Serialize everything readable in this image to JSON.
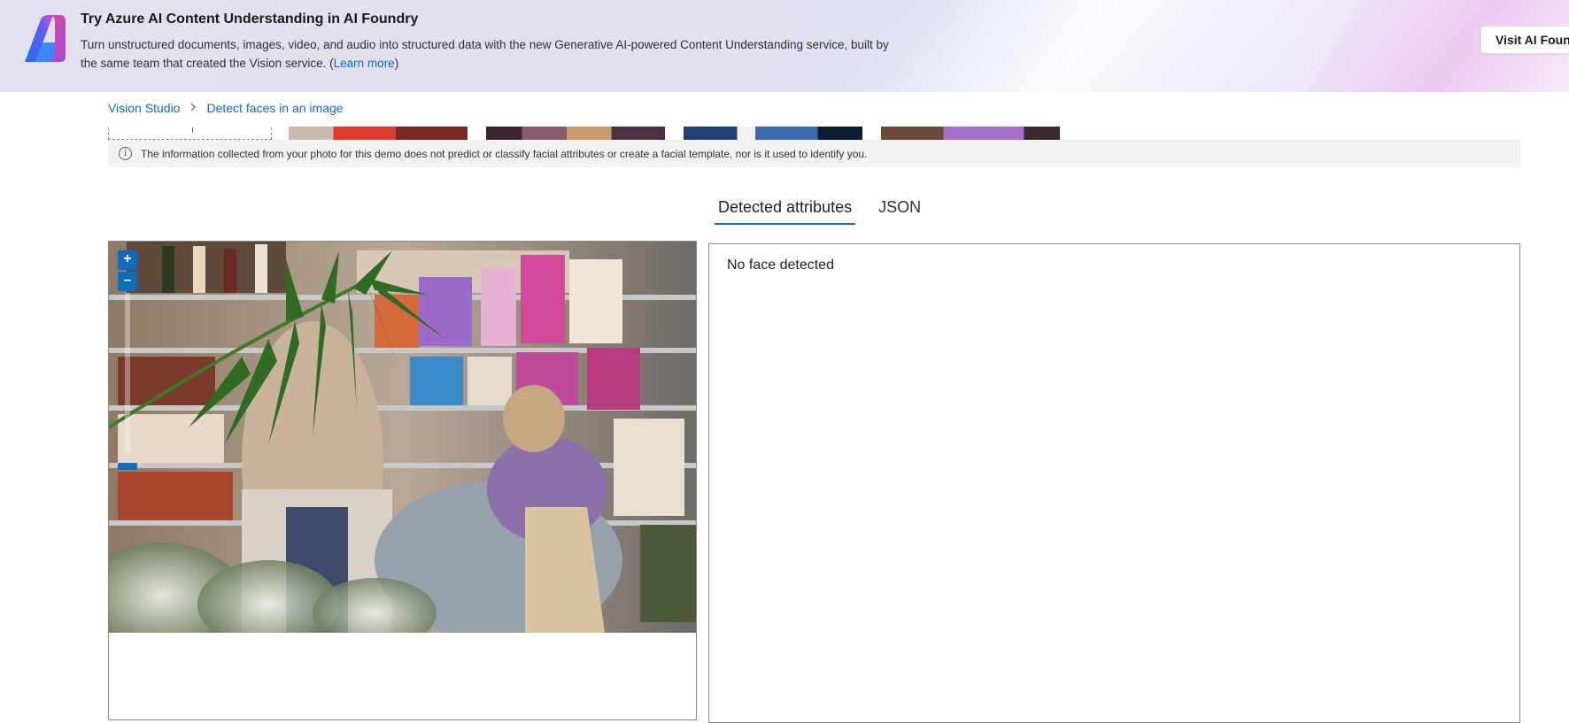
{
  "banner": {
    "title": "Try Azure AI Content Understanding in AI Foundry",
    "description": "Turn unstructured documents, images, video, and audio into structured data with the new Generative AI-powered Content Understanding service, built by the same team that created the Vision service. (",
    "learn_more": "Learn more",
    "desc_close": ")",
    "visit_button": "Visit AI Foundry",
    "logo_icon": "azure-ai-foundry-logo"
  },
  "breadcrumb": {
    "items": [
      "Vision Studio",
      "Detect faces in an image"
    ],
    "separator_icon": "chevron-right-icon"
  },
  "notice": {
    "icon": "info-icon",
    "text": "The information collected from your photo for this demo does not predict or classify facial attributes or create a facial template, nor is it used to identify you."
  },
  "tabs": [
    {
      "label": "Detected attributes",
      "selected": true
    },
    {
      "label": "JSON",
      "selected": false
    }
  ],
  "viewer": {
    "zoom_in": "+",
    "zoom_out": "–"
  },
  "results": {
    "message": "No face detected"
  },
  "colors": {
    "accent": "#0f6cbd",
    "notice_bg": "#f2f2f2"
  }
}
